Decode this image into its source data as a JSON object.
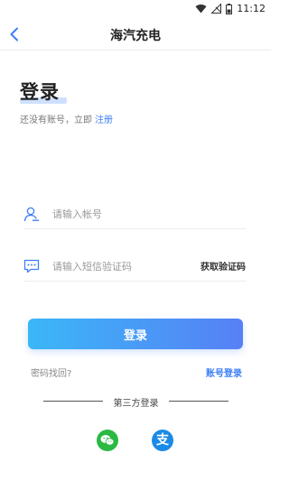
{
  "status_bar": {
    "time": "11:12",
    "icons": [
      "wifi-icon",
      "signal-off-icon",
      "battery-icon"
    ]
  },
  "nav": {
    "title": "海汽充电",
    "back_icon": "chevron-left-icon"
  },
  "login": {
    "title": "登录",
    "no_account_text": "还没有账号，立即",
    "register_link": "注册"
  },
  "form": {
    "account_placeholder": "请输入帐号",
    "code_placeholder": "请输入短信验证码",
    "get_code_label": "获取验证码",
    "submit_label": "登录"
  },
  "links": {
    "forgot_password": "密码找回?",
    "account_login": "账号登录"
  },
  "third_party": {
    "label": "第三方登录",
    "providers": [
      {
        "name": "wechat",
        "icon": "wechat-icon",
        "color": "#2bb944"
      },
      {
        "name": "alipay",
        "icon": "alipay-icon",
        "color": "#1a8ae6",
        "glyph": "支"
      }
    ]
  },
  "colors": {
    "accent": "#3d7ff5",
    "button_gradient_start": "#3bb7f7",
    "button_gradient_end": "#5680f6"
  }
}
